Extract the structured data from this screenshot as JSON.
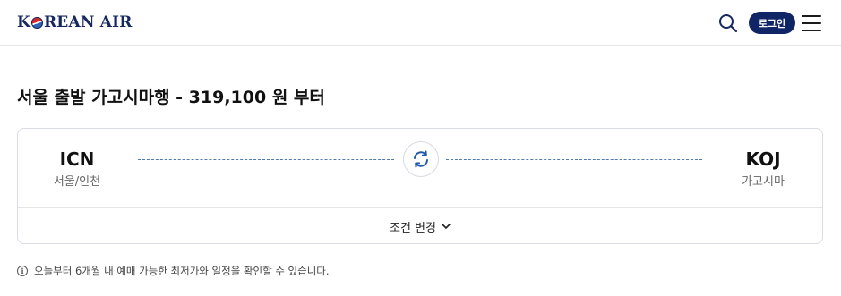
{
  "header": {
    "logo_text": "KOREAN AIR",
    "login_label": "로그인",
    "search_icon": "search-icon",
    "menu_icon": "hamburger-menu-icon"
  },
  "main": {
    "title": "서울 출발 가고시마행 - 319,100 원 부터",
    "route": {
      "origin": {
        "code": "ICN",
        "city": "서울/인천"
      },
      "destination": {
        "code": "KOJ",
        "city": "가고시마"
      },
      "swap_icon": "swap-icon"
    },
    "change_conditions_label": "조건 변경",
    "notice": "오늘부터 6개월 내 예매 가능한 최저가와 일정을 확인할 수 있습니다."
  },
  "colors": {
    "brand_navy": "#0f2566",
    "route_line": "#4f7bb0",
    "swap_icon": "#1f5aa8"
  }
}
